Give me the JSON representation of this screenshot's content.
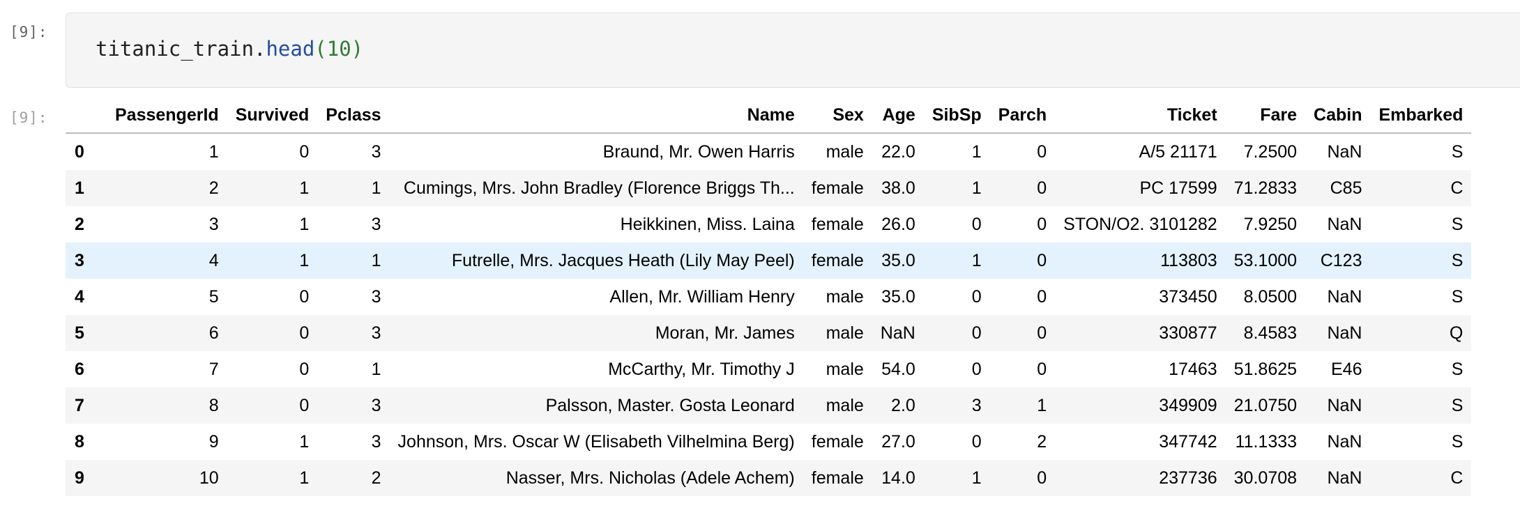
{
  "input_prompt": "[9]:",
  "output_prompt": "[9]:",
  "code": {
    "object": "titanic_train.",
    "method": "head",
    "open_paren": "(",
    "arg": "10",
    "close_paren": ")"
  },
  "table": {
    "columns": [
      "PassengerId",
      "Survived",
      "Pclass",
      "Name",
      "Sex",
      "Age",
      "SibSp",
      "Parch",
      "Ticket",
      "Fare",
      "Cabin",
      "Embarked"
    ],
    "rows": [
      {
        "index": "0",
        "cells": [
          "1",
          "0",
          "3",
          "Braund, Mr. Owen Harris",
          "male",
          "22.0",
          "1",
          "0",
          "A/5 21171",
          "7.2500",
          "NaN",
          "S"
        ]
      },
      {
        "index": "1",
        "cells": [
          "2",
          "1",
          "1",
          "Cumings, Mrs. John Bradley (Florence Briggs Th...",
          "female",
          "38.0",
          "1",
          "0",
          "PC 17599",
          "71.2833",
          "C85",
          "C"
        ]
      },
      {
        "index": "2",
        "cells": [
          "3",
          "1",
          "3",
          "Heikkinen, Miss. Laina",
          "female",
          "26.0",
          "0",
          "0",
          "STON/O2. 3101282",
          "7.9250",
          "NaN",
          "S"
        ]
      },
      {
        "index": "3",
        "cells": [
          "4",
          "1",
          "1",
          "Futrelle, Mrs. Jacques Heath (Lily May Peel)",
          "female",
          "35.0",
          "1",
          "0",
          "113803",
          "53.1000",
          "C123",
          "S"
        ]
      },
      {
        "index": "4",
        "cells": [
          "5",
          "0",
          "3",
          "Allen, Mr. William Henry",
          "male",
          "35.0",
          "0",
          "0",
          "373450",
          "8.0500",
          "NaN",
          "S"
        ]
      },
      {
        "index": "5",
        "cells": [
          "6",
          "0",
          "3",
          "Moran, Mr. James",
          "male",
          "NaN",
          "0",
          "0",
          "330877",
          "8.4583",
          "NaN",
          "Q"
        ]
      },
      {
        "index": "6",
        "cells": [
          "7",
          "0",
          "1",
          "McCarthy, Mr. Timothy J",
          "male",
          "54.0",
          "0",
          "0",
          "17463",
          "51.8625",
          "E46",
          "S"
        ]
      },
      {
        "index": "7",
        "cells": [
          "8",
          "0",
          "3",
          "Palsson, Master. Gosta Leonard",
          "male",
          "2.0",
          "3",
          "1",
          "349909",
          "21.0750",
          "NaN",
          "S"
        ]
      },
      {
        "index": "8",
        "cells": [
          "9",
          "1",
          "3",
          "Johnson, Mrs. Oscar W (Elisabeth Vilhelmina Berg)",
          "female",
          "27.0",
          "0",
          "2",
          "347742",
          "11.1333",
          "NaN",
          "S"
        ]
      },
      {
        "index": "9",
        "cells": [
          "10",
          "1",
          "2",
          "Nasser, Mrs. Nicholas (Adele Achem)",
          "female",
          "14.0",
          "1",
          "0",
          "237736",
          "30.0708",
          "NaN",
          "C"
        ]
      }
    ],
    "hovered_row": 3
  },
  "colors": {
    "cell_background": "#f5f5f5",
    "row_hover": "#e3f2fd",
    "code_method": "#1f4e9e",
    "code_number": "#2e7d32"
  }
}
